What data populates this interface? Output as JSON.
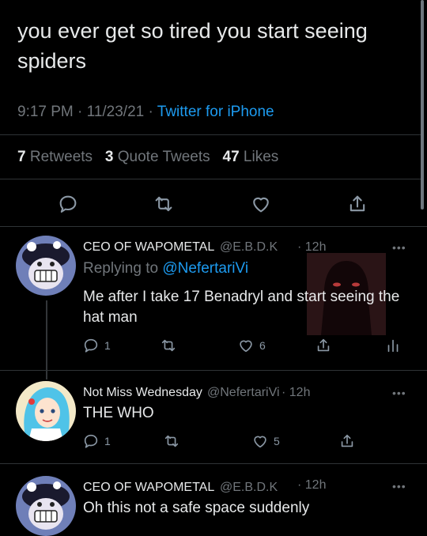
{
  "main_tweet": {
    "text": "you ever get so tired you start seeing spiders",
    "time": "9:17 PM",
    "date": "11/23/21",
    "source": "Twitter for iPhone",
    "sep1": "·",
    "sep2": "·",
    "retweets_count": "7",
    "retweets_label": "Retweets",
    "quotes_count": "3",
    "quotes_label": "Quote Tweets",
    "likes_count": "47",
    "likes_label": "Likes"
  },
  "replies": [
    {
      "name": "CEO OF WAPOMETAL",
      "handle": "@E.B.D.K",
      "time": "· 12h",
      "more": "•••",
      "replying_label": "Replying to",
      "replying_to": "@NefertariVi",
      "text": "Me after I take 17 Benadryl and start seeing the hat man",
      "reply_count": "1",
      "like_count": "6",
      "avatar_icon": "avatar-clown-icon"
    },
    {
      "name": "Not Miss Wednesday",
      "handle": "@NefertariVi",
      "time": "· 12h",
      "more": "•••",
      "text": "THE WHO",
      "reply_count": "1",
      "like_count": "5",
      "avatar_icon": "avatar-blue-hair-icon"
    },
    {
      "name": "CEO OF WAPOMETAL",
      "handle": "@E.B.D.K",
      "time": "· 12h",
      "more": "•••",
      "text": "Oh this not a safe space suddenly",
      "avatar_icon": "avatar-clown-icon"
    }
  ],
  "colors": {
    "background": "#000000",
    "text": "#e7e9ea",
    "muted": "#71767b",
    "accent": "#1d9bf0",
    "divider": "#2f3336"
  }
}
